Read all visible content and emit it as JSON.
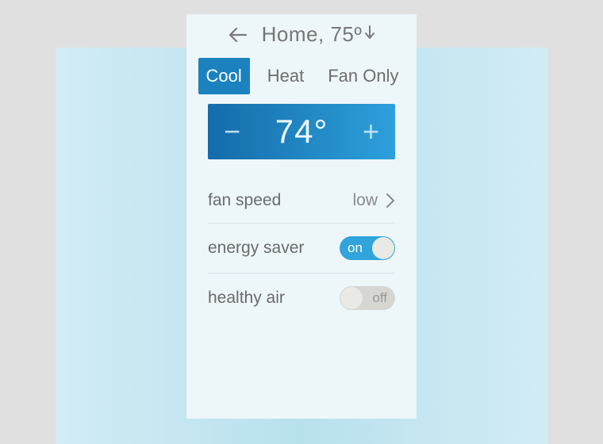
{
  "header": {
    "title": "Home, 75º"
  },
  "tabs": {
    "cool": "Cool",
    "heat": "Heat",
    "fan_only": "Fan Only"
  },
  "temp": {
    "value": "74°"
  },
  "settings": {
    "fan_speed_label": "fan speed",
    "fan_speed_value": "low",
    "energy_saver_label": "energy saver",
    "energy_saver_state": "on",
    "healthy_air_label": "healthy air",
    "healthy_air_state": "off"
  }
}
